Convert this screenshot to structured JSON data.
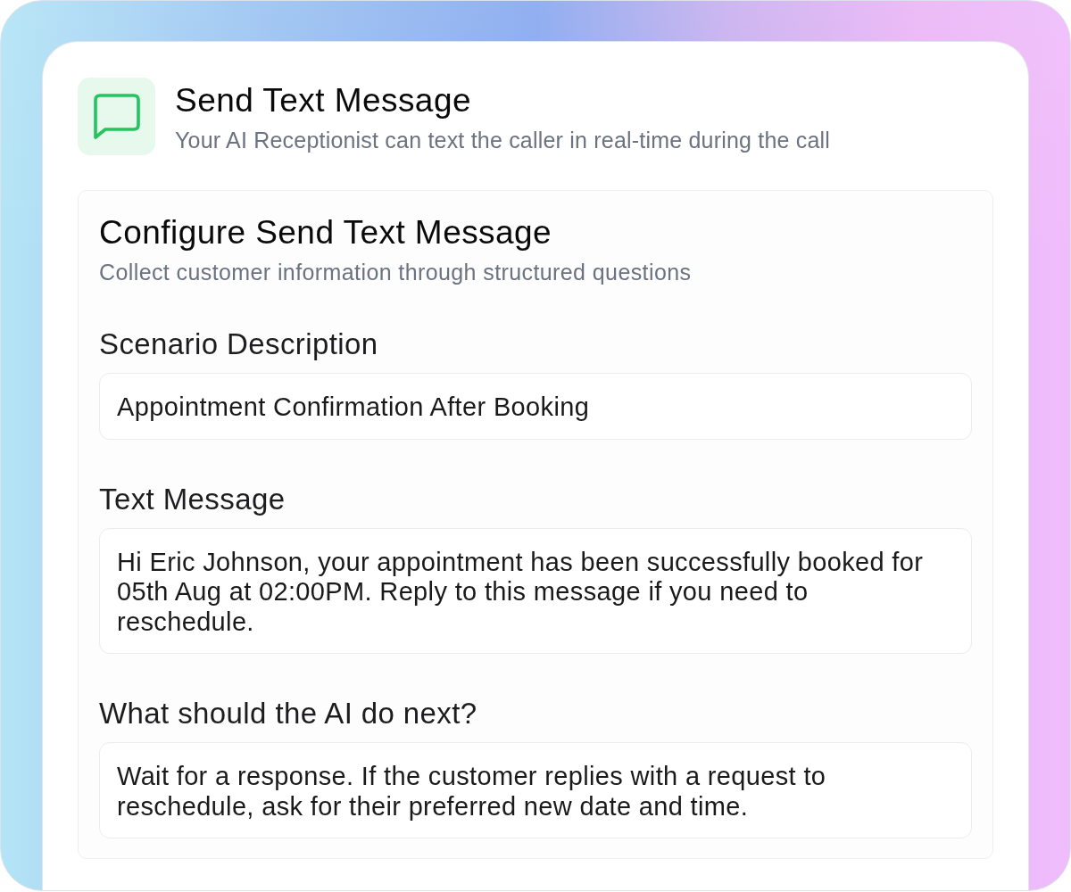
{
  "header": {
    "title": "Send Text Message",
    "subtitle": "Your AI Receptionist can text the caller in real-time during the call"
  },
  "panel": {
    "title": "Configure Send Text Message",
    "subtitle": "Collect customer information through structured questions",
    "fields": [
      {
        "label": "Scenario Description",
        "value": "Appointment Confirmation After Booking"
      },
      {
        "label": "Text Message",
        "value": "Hi Eric Johnson, your appointment has been successfully booked for 05th Aug at 02:00PM. Reply to this message if you need to reschedule."
      },
      {
        "label": "What should the AI do next?",
        "value": "Wait for a response. If the customer replies with a request to reschedule, ask for their preferred new date and time."
      }
    ]
  }
}
